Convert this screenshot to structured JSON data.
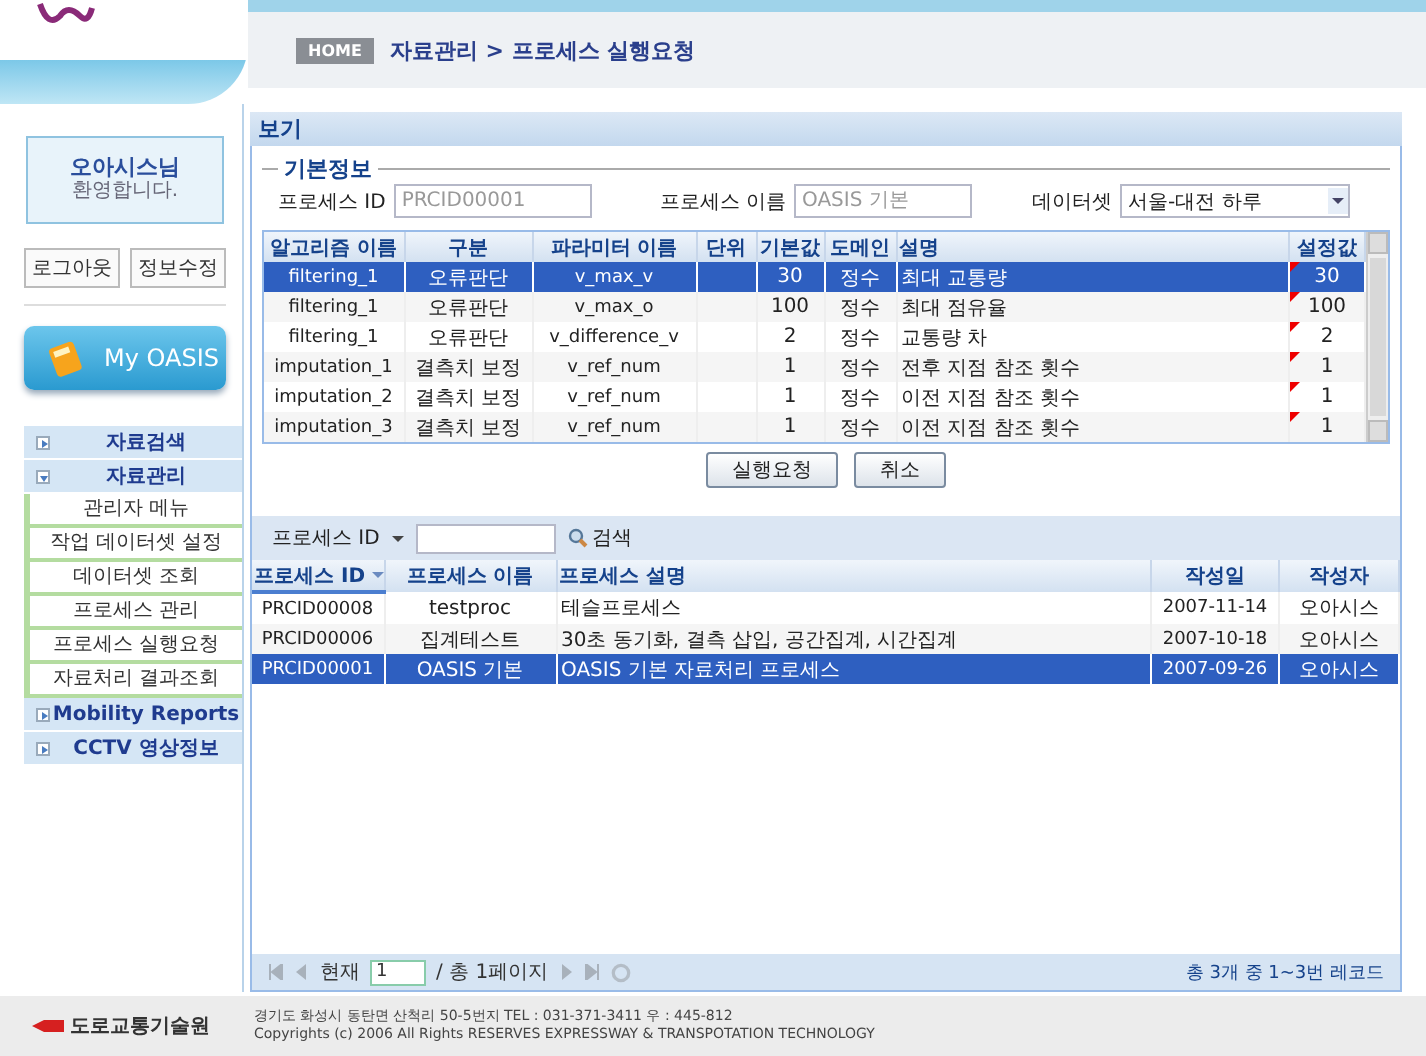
{
  "header": {
    "home_label": "HOME",
    "breadcrumb": "자료관리 > 프로세스 실행요청"
  },
  "sidebar": {
    "welcome_name": "오아시스님",
    "welcome_text": "환영합니다.",
    "buttons": [
      "로그아웃",
      "정보수정"
    ],
    "my_oasis": "My OASIS",
    "menu": [
      {
        "label": "자료검색",
        "expanded": false
      },
      {
        "label": "자료관리",
        "expanded": true,
        "children": [
          {
            "label": "관리자 메뉴"
          },
          {
            "label": "작업 데이터셋 설정"
          },
          {
            "label": "데이터셋 조회"
          },
          {
            "label": "프로세스 관리"
          },
          {
            "label": "프로세스 실행요청"
          },
          {
            "label": "자료처리 결과조회"
          }
        ]
      },
      {
        "label": "Mobility Reports",
        "expanded": false
      },
      {
        "label": "CCTV 영상정보",
        "expanded": false
      }
    ]
  },
  "panel": {
    "title": "보기",
    "basic_info": {
      "legend": "기본정보",
      "fields": [
        {
          "label": "프로세스 ID",
          "value": "PRCID00001",
          "kind": "text"
        },
        {
          "label": "프로세스 이름",
          "value": "OASIS 기본",
          "kind": "text"
        },
        {
          "label": "데이터셋",
          "value": "서울-대전 하루",
          "kind": "select"
        }
      ]
    },
    "params_table": {
      "columns": [
        "알고리즘 이름",
        "구분",
        "파라미터 이름",
        "단위",
        "기본값",
        "도메인",
        "설명",
        "설정값"
      ],
      "rows": [
        {
          "cells": [
            "filtering_1",
            "오류판단",
            "v_max_v",
            "",
            "30",
            "정수",
            "최대 교통량",
            "30"
          ],
          "selected": true,
          "modified": true
        },
        {
          "cells": [
            "filtering_1",
            "오류판단",
            "v_max_o",
            "",
            "100",
            "정수",
            "최대 점유율",
            "100"
          ],
          "selected": false,
          "modified": true
        },
        {
          "cells": [
            "filtering_1",
            "오류판단",
            "v_difference_v",
            "",
            "2",
            "정수",
            "교통량 차",
            "2"
          ],
          "selected": false,
          "modified": true
        },
        {
          "cells": [
            "imputation_1",
            "결측치 보정",
            "v_ref_num",
            "",
            "1",
            "정수",
            "전후 지점 참조 횟수",
            "1"
          ],
          "selected": false,
          "modified": true
        },
        {
          "cells": [
            "imputation_2",
            "결측치 보정",
            "v_ref_num",
            "",
            "1",
            "정수",
            "이전 지점 참조 횟수",
            "1"
          ],
          "selected": false,
          "modified": true
        },
        {
          "cells": [
            "imputation_3",
            "결측치 보정",
            "v_ref_num",
            "",
            "1",
            "정수",
            "이전 지점 참조 횟수",
            "1"
          ],
          "selected": false,
          "modified": true
        }
      ]
    },
    "actions": [
      "실행요청",
      "취소"
    ],
    "search": {
      "field_label": "프로세스 ID",
      "button": "검색"
    },
    "process_table": {
      "columns": [
        {
          "label": "프로세스 ID",
          "sorted": true
        },
        {
          "label": "프로세스 이름",
          "sorted": false
        },
        {
          "label": "프로세스 설명",
          "sorted": false
        },
        {
          "label": "작성일",
          "sorted": false
        },
        {
          "label": "작성자",
          "sorted": false
        }
      ],
      "rows": [
        {
          "cells": [
            "PRCID00008",
            "testproc",
            "테슬프로세스",
            "2007-11-14",
            "오아시스"
          ],
          "selected": false
        },
        {
          "cells": [
            "PRCID00006",
            "집계테스트",
            "30초 동기화, 결측 삽입, 공간집계, 시간집계",
            "2007-10-18",
            "오아시스"
          ],
          "selected": false
        },
        {
          "cells": [
            "PRCID00001",
            "OASIS 기본",
            "OASIS 기본 자료처리 프로세스",
            "2007-09-26",
            "오아시스"
          ],
          "selected": true
        }
      ]
    },
    "pager": {
      "current_label": "현재",
      "page": "1",
      "total_label": "/ 총 1페이지",
      "summary": "총 3개 중 1~3번 레코드"
    }
  },
  "footer": {
    "org_name": "도로교통기술원",
    "address": "경기도 화성시 동탄면 산척리 50-5번지 TEL : 031-371-3411 우 : 445-812",
    "copyright": "Copyrights (c) 2006 All Rights RESERVES EXPRESSWAY & TRANSPOTATION TECHNOLOGY"
  }
}
